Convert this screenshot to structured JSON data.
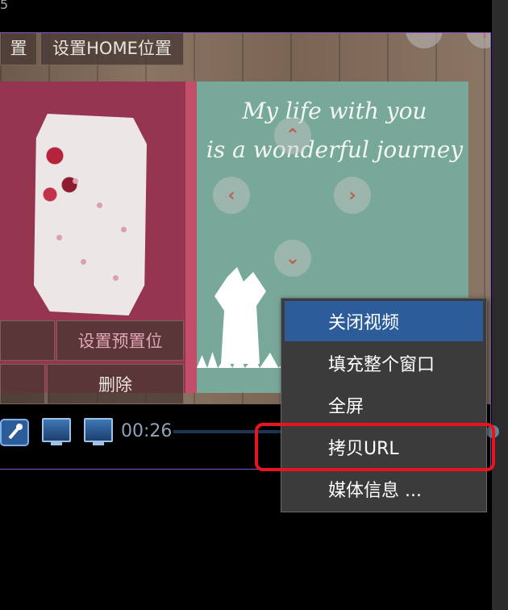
{
  "window": {
    "corner_label": "5"
  },
  "video": {
    "card_line1": "My life with you",
    "card_line2": "is a wonderful journey",
    "zoom_out_label": "−",
    "zoom_in_label": "+",
    "ptz": {
      "up": "⌃",
      "down": "⌄",
      "left": "‹",
      "right": "›"
    }
  },
  "overlay_buttons": {
    "set_position": "置",
    "set_home": "设置HOME位置",
    "set_preset": "设置预置位",
    "delete": "删除"
  },
  "player": {
    "time": "00:26",
    "progress_fraction": 0.98
  },
  "context_menu": {
    "items": [
      {
        "label": "关闭视频",
        "active": true
      },
      {
        "label": "填充整个窗口",
        "active": false
      },
      {
        "label": "全屏",
        "active": false
      },
      {
        "label": "拷贝URL",
        "active": false
      },
      {
        "label": "媒体信息 ...",
        "active": false
      }
    ]
  },
  "colors": {
    "menu_background": "#3b3b3b",
    "menu_active": "#2c5d9a",
    "highlight_box": "#e8141e",
    "frame_border": "#8a4fd0"
  }
}
